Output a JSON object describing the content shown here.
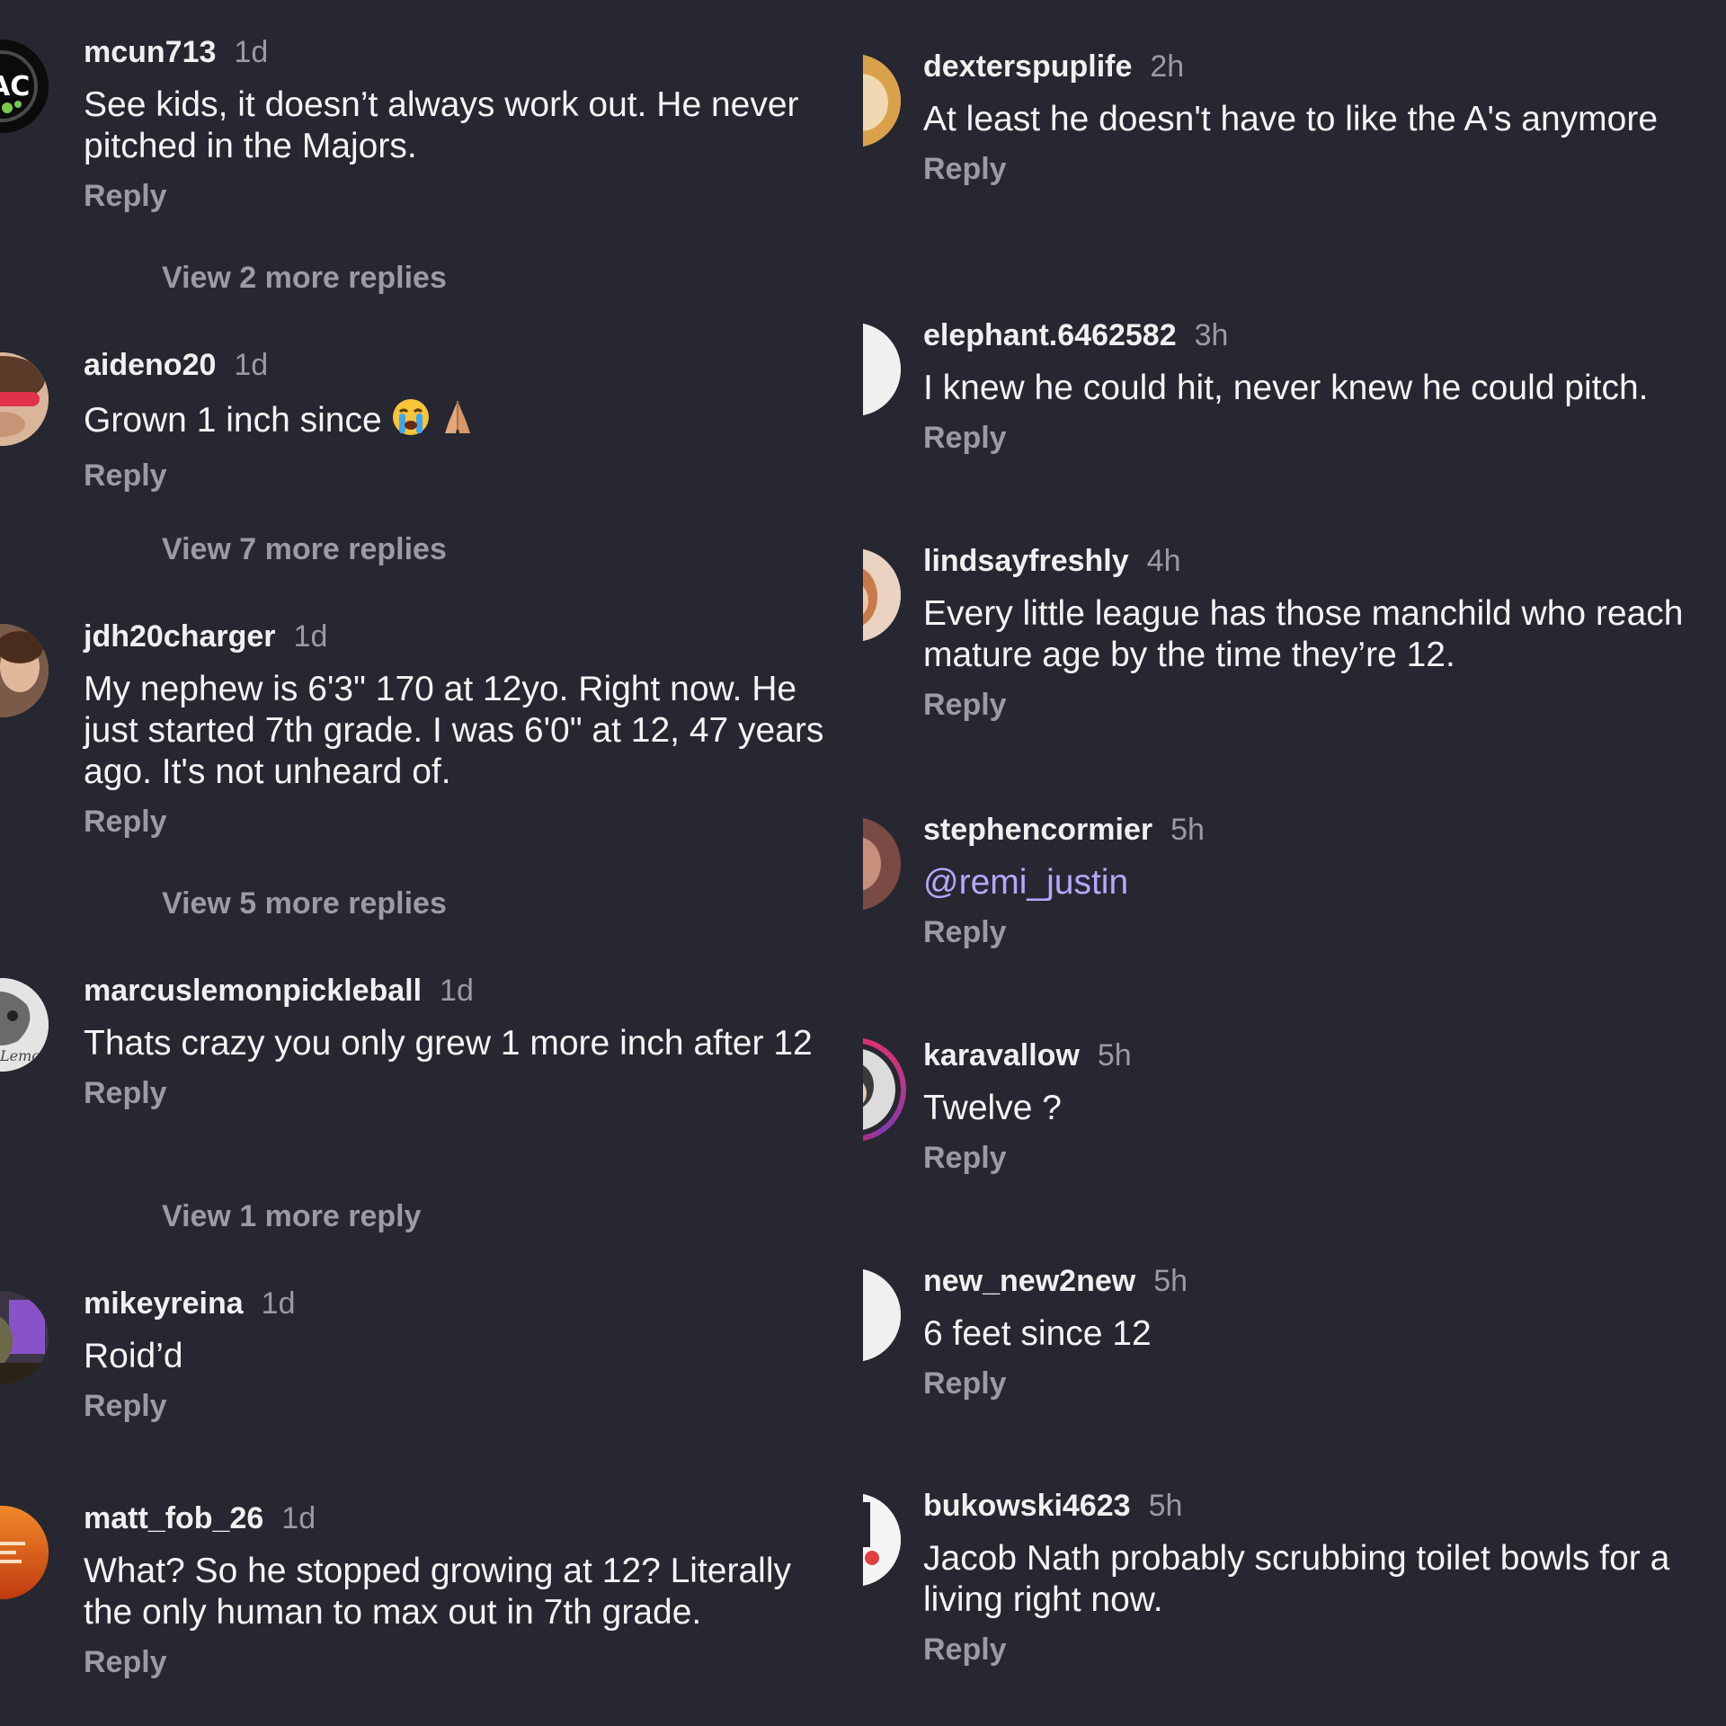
{
  "left_comments": [
    {
      "username": "mcun713",
      "time": "1d",
      "text": "See kids, it doesn’t always work out. He never pitched in the Majors.",
      "reply": "Reply",
      "view_more": "View 2 more replies"
    },
    {
      "username": "aideno20",
      "time": "1d",
      "text": "Grown 1 inch since",
      "reply": "Reply",
      "view_more": "View 7 more replies"
    },
    {
      "username": "jdh20charger",
      "time": "1d",
      "text": "My nephew is 6'3\" 170 at 12yo.  Right now.  He just started 7th grade.  I was 6'0\" at 12, 47 years ago.  It's not unheard of.",
      "reply": "Reply",
      "view_more": "View 5 more replies"
    },
    {
      "username": "marcuslemonpickleball",
      "time": "1d",
      "text": "Thats crazy you only grew 1 more inch after 12",
      "reply": "Reply",
      "view_more": "View 1 more reply"
    },
    {
      "username": "mikeyreina",
      "time": "1d",
      "text": "Roid’d",
      "reply": "Reply"
    },
    {
      "username": "matt_fob_26",
      "time": "1d",
      "text": "What? So he stopped growing at 12?  Literally the only human to max out in 7th grade.",
      "reply": "Reply"
    }
  ],
  "right_comments": [
    {
      "username": "dexterspuplife",
      "time": "2h",
      "text": "At least he doesn't have to like the A's anymore",
      "reply": "Reply"
    },
    {
      "username": "elephant.6462582",
      "time": "3h",
      "text": "I knew he could hit, never knew he could pitch.",
      "reply": "Reply"
    },
    {
      "username": "lindsayfreshly",
      "time": "4h",
      "text": "Every little league has those manchild who reach mature age by the time they’re 12.",
      "reply": "Reply"
    },
    {
      "username": "stephencormier",
      "time": "5h",
      "text": "@remi_justin",
      "reply": "Reply"
    },
    {
      "username": "karavallow",
      "time": "5h",
      "text": "Twelve ?",
      "reply": "Reply"
    },
    {
      "username": "new_new2new",
      "time": "5h",
      "text": "6 feet since 12",
      "reply": "Reply"
    },
    {
      "username": "bukowski4623",
      "time": "5h",
      "text": "Jacob Nath probably scrubbing toilet bowls for a living right now.",
      "reply": "Reply"
    }
  ],
  "colors": {
    "background": "#262730",
    "text": "#f4f4f4",
    "muted": "#9a9ba3",
    "mention": "#b9a6ff"
  }
}
